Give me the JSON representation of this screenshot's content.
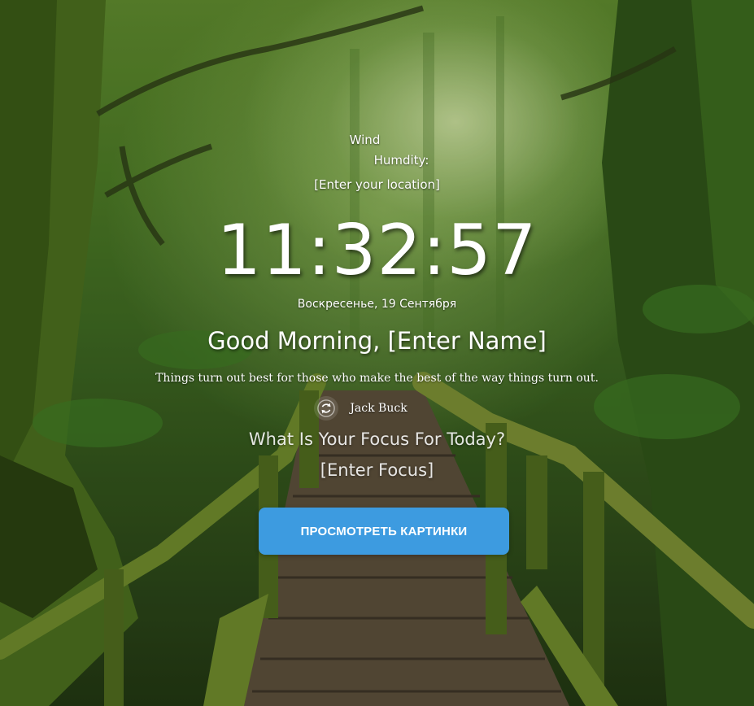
{
  "weather": {
    "wind_label": "Wind",
    "humidity_label": "Humdity:",
    "location_placeholder": "[Enter your location]"
  },
  "clock": {
    "time": "11:32:57",
    "date": "Воскресенье, 19 Сентября"
  },
  "greeting": {
    "prefix": "Good Morning,",
    "name_placeholder": "[Enter Name]"
  },
  "quote": {
    "text": "Things turn out best for those who make the best of the way things turn out.",
    "author": "Jack Buck",
    "refresh_icon": "refresh-icon"
  },
  "focus": {
    "question": "What Is Your Focus For Today?",
    "placeholder": "[Enter Focus]"
  },
  "actions": {
    "view_pictures_label": "ПРОСМОТРЕТЬ КАРТИНКИ"
  },
  "colors": {
    "button_bg": "#3d9be0",
    "text": "#ffffff"
  },
  "background": "forest-boardwalk-image"
}
